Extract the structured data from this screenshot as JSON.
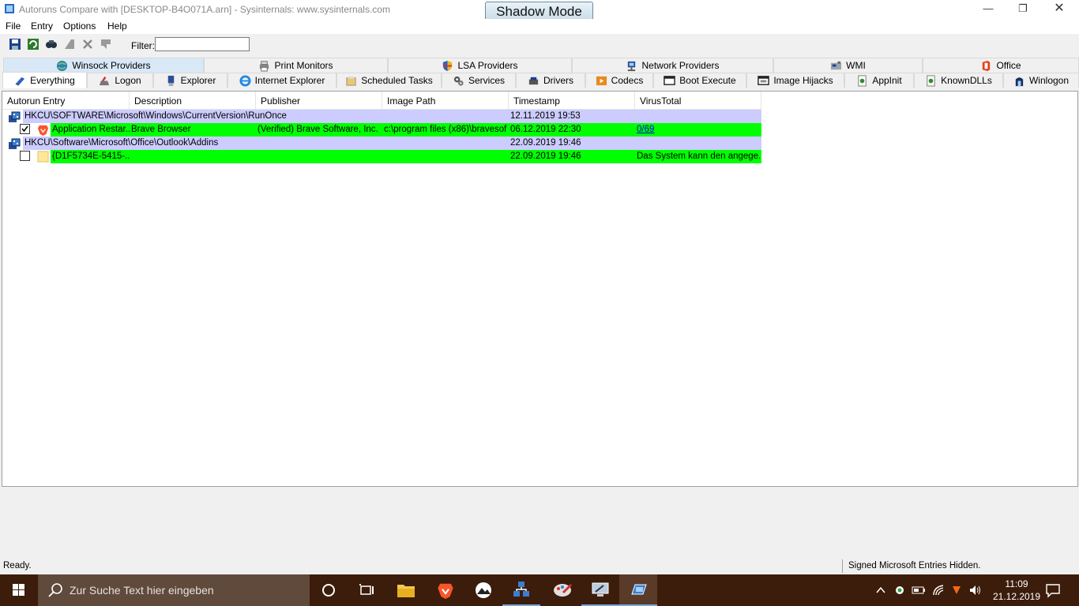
{
  "window": {
    "title": "Autoruns Compare with [DESKTOP-B4O071A.arn] - Sysinternals: www.sysinternals.com",
    "shadow_mode_label": "Shadow Mode"
  },
  "menu": [
    "File",
    "Entry",
    "Options",
    "Help"
  ],
  "toolbar": {
    "icons": [
      "save-icon",
      "refresh-icon",
      "find-icon",
      "properties-icon",
      "delete-icon",
      "jump-icon"
    ],
    "filter_label": "Filter:",
    "filter_value": ""
  },
  "tabs_top": [
    "Winsock Providers",
    "Print Monitors",
    "LSA Providers",
    "Network Providers",
    "WMI",
    "Office"
  ],
  "tabs_bottom": [
    "Everything",
    "Logon",
    "Explorer",
    "Internet Explorer",
    "Scheduled Tasks",
    "Services",
    "Drivers",
    "Codecs",
    "Boot Execute",
    "Image Hijacks",
    "AppInit",
    "KnownDLLs",
    "Winlogon"
  ],
  "columns": [
    "Autorun Entry",
    "Description",
    "Publisher",
    "Image Path",
    "Timestamp",
    "VirusTotal"
  ],
  "rows": [
    {
      "kind": "group",
      "entry": "HKCU\\SOFTWARE\\Microsoft\\Windows\\CurrentVersion\\RunOnce",
      "timestamp": "12.11.2019 19:53"
    },
    {
      "kind": "entry",
      "checked": true,
      "entry": "Application Restar...",
      "description": "Brave Browser",
      "publisher": "(Verified) Brave Software, Inc.",
      "image_path": "c:\\program files (x86)\\bravesof...",
      "timestamp": "06.12.2019 22:30",
      "virustotal": "0/69"
    },
    {
      "kind": "group",
      "entry": "HKCU\\Software\\Microsoft\\Office\\Outlook\\Addins",
      "timestamp": "22.09.2019 19:46"
    },
    {
      "kind": "entry",
      "checked": false,
      "entry": "{D1F5734E-5415-...",
      "description": "",
      "publisher": "",
      "image_path": "",
      "timestamp": "22.09.2019 19:46",
      "virustotal": "Das System kann den angege..."
    }
  ],
  "status": {
    "left": "Ready.",
    "right": "Signed Microsoft Entries Hidden."
  },
  "taskbar": {
    "search_placeholder": "Zur Suche Text hier eingeben",
    "clock_time": "11:09",
    "clock_date": "21.12.2019"
  },
  "colors": {
    "group_row": "#ccccff",
    "entry_row": "#00ff00",
    "taskbar": "#3c1c0a"
  }
}
